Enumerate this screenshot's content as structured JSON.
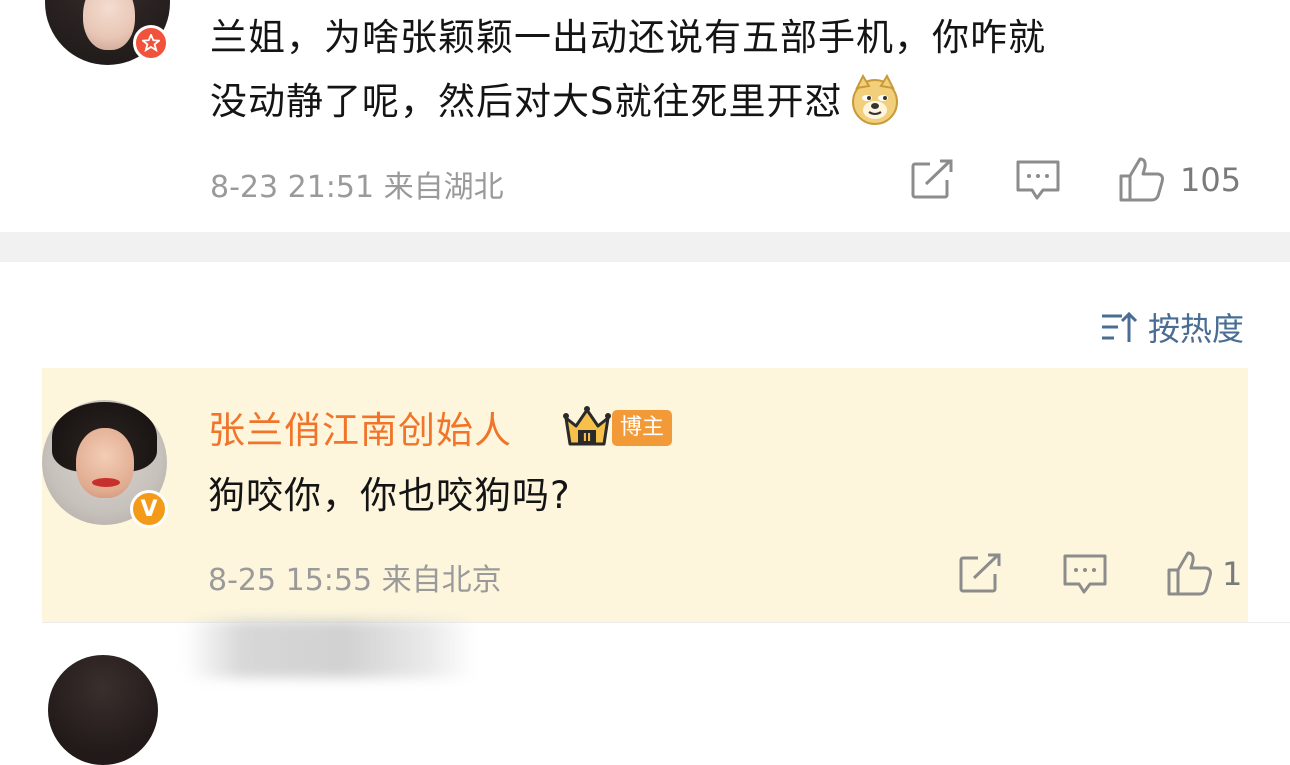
{
  "comment1": {
    "line1": "兰姐，为啥张颖颖一出动还说有五部手机，你咋就",
    "line2": "没动静了呢，然后对大S就往死里开怼",
    "emoji": "doge-emoji",
    "time": "8-23 21:51",
    "location": "来自湖北",
    "like_count": "105",
    "badge_color": "#f0523b"
  },
  "sort": {
    "label": "按热度",
    "icon": "sort-icon"
  },
  "reply": {
    "username": "张兰俏江南创始人",
    "crown_icon": "crown-level-icon",
    "crown_level": "II",
    "tag": "博主",
    "text": "狗咬你，你也咬狗吗?",
    "time": "8-25 15:55",
    "location": "来自北京",
    "like_count": "1",
    "verified_badge": "V",
    "name_color": "#f0752a",
    "card_color": "#fdf6dd"
  }
}
